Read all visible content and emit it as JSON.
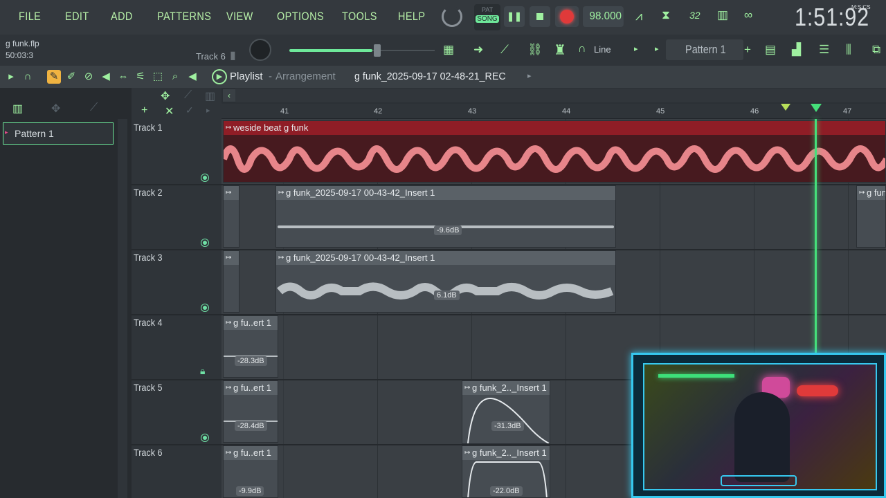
{
  "menu": {
    "items": [
      "FILE",
      "EDIT",
      "ADD",
      "PATTERNS",
      "VIEW",
      "OPTIONS",
      "TOOLS",
      "HELP"
    ]
  },
  "transport": {
    "pat_label": "PAT",
    "song_label": "SONG",
    "tempo": "98.000",
    "time_display": "1:51:92",
    "time_format": "M:S:CS",
    "pattern_name": "Pattern 1",
    "snap_mode": "Line",
    "cpu_value": "32"
  },
  "hint": {
    "project_file": "g funk.flp",
    "position": "50:03:3",
    "track_name": "Track 6"
  },
  "playlist": {
    "title": "Playlist",
    "subtitle": "Arrangement",
    "arrangement_name": "g funk_2025-09-17 02-48-21_REC"
  },
  "browser": {
    "selected_item": "Pattern 1"
  },
  "ruler": {
    "bars": [
      "41",
      "42",
      "43",
      "44",
      "45",
      "46",
      "47"
    ]
  },
  "tracks": [
    {
      "label": "Track 1"
    },
    {
      "label": "Track 2"
    },
    {
      "label": "Track 3"
    },
    {
      "label": "Track 4"
    },
    {
      "label": "Track 5"
    },
    {
      "label": "Track 6"
    }
  ],
  "clips": {
    "c1": {
      "name": "weside beat g funk"
    },
    "c2a": {
      "name": ""
    },
    "c2b": {
      "name": "g funk_2025-09-17 00-43-42_Insert 1",
      "db": "-9.6dB"
    },
    "c2c": {
      "name": "g fun"
    },
    "c3a": {
      "name": ""
    },
    "c3b": {
      "name": "g funk_2025-09-17 00-43-42_Insert 1",
      "db": "6.1dB"
    },
    "c4a": {
      "name": "g fu..ert 1",
      "db": "-28.3dB"
    },
    "c5a": {
      "name": "g fu..ert 1",
      "db": "-28.4dB"
    },
    "c5b": {
      "name": "g funk_2.._Insert 1",
      "db": "-31.3dB"
    },
    "c6a": {
      "name": "g fu..ert 1",
      "db": "-9.9dB"
    },
    "c6b": {
      "name": "g funk_2.._Insert 1",
      "db": "-22.0dB"
    }
  },
  "colors": {
    "accent": "#9ff0a0",
    "audio_clip_red": "#8f1d26",
    "waveform_pink": "#e7858a",
    "playhead": "#45e07a",
    "record": "#e03a3a"
  }
}
